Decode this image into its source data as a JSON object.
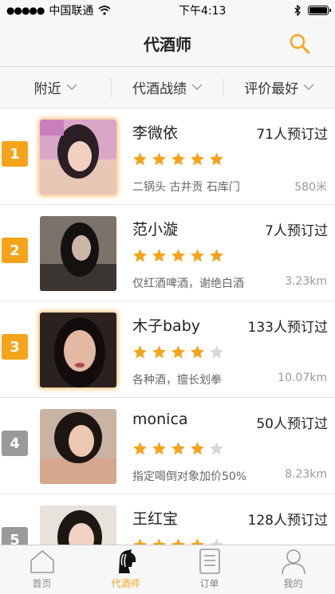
{
  "status": {
    "carrier": "中国联通",
    "time": "下午4:13"
  },
  "nav": {
    "title": "代酒师"
  },
  "filters": [
    {
      "label": "附近"
    },
    {
      "label": "代酒战绩"
    },
    {
      "label": "评价最好"
    }
  ],
  "rows": [
    {
      "rank": "1",
      "name": "李微依",
      "count": "71人预订过",
      "stars": 5,
      "desc": "二锅头 古井贡 石库门",
      "dist": "580米"
    },
    {
      "rank": "2",
      "name": "范小漩",
      "count": "7人预订过",
      "stars": 5,
      "desc": "仅红酒啤酒，谢绝白酒",
      "dist": "3.23km"
    },
    {
      "rank": "3",
      "name": "木子baby",
      "count": "133人预订过",
      "stars": 4,
      "desc": "各种酒，擅长划拳",
      "dist": "10.07km"
    },
    {
      "rank": "4",
      "name": "monica",
      "count": "50人预订过",
      "stars": 4,
      "desc": "指定喝倒对象加价50%",
      "dist": "8.23km"
    },
    {
      "rank": "5",
      "name": "王红宝",
      "count": "128人预订过",
      "stars": 4,
      "desc": "",
      "dist": ""
    }
  ],
  "tabs": [
    {
      "label": "首页"
    },
    {
      "label": "代酒师"
    },
    {
      "label": "订单"
    },
    {
      "label": "我的"
    }
  ],
  "colors": {
    "accent": "#f5a31a",
    "rank_gray": "#9a9a9a",
    "star_empty": "#d8d8d8"
  }
}
